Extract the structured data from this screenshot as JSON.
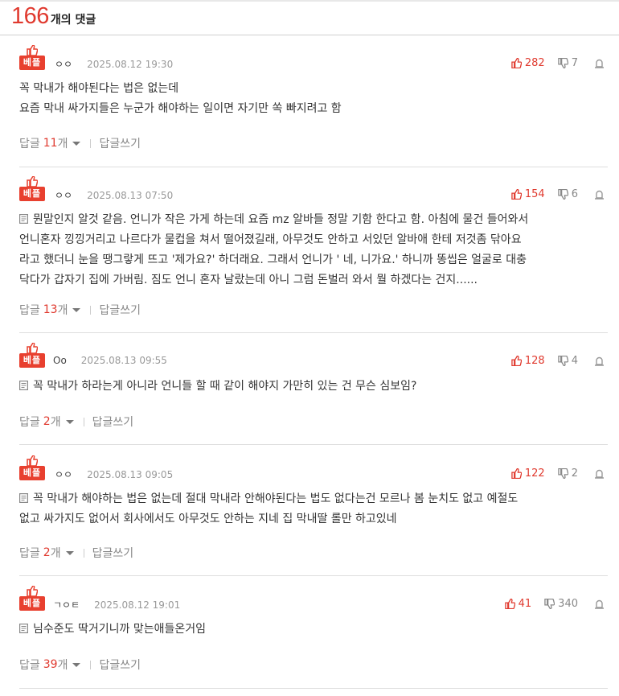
{
  "header": {
    "count": "166",
    "label": "개의 댓글"
  },
  "comments": [
    {
      "badge": "베플",
      "nick": "ㅇㅇ",
      "date": "2025.08.12 19:30",
      "up": "282",
      "down": "7",
      "lines": [
        "꼭 막내가 해야된다는 법은 없는데",
        "요즘 막내 싸가지들은 누군가 해야하는 일이면 자기만 쏙 빠지려고 함"
      ],
      "reply_label": "답글",
      "reply_count": "11",
      "reply_unit": "개",
      "write_label": "답글쓰기"
    },
    {
      "badge": "베플",
      "nick": "ㅇㅇ",
      "date": "2025.08.13 07:50",
      "up": "154",
      "down": "6",
      "lines": [
        "뭔말인지 알것 같음. 언니가 작은 가게 하는데 요즘 mz 알바들 정말 기함 한다고 함. 아침에 물건 들어와서",
        "언니혼자 낑낑거리고 나르다가 물컵을 쳐서 떨어졌길래, 아무것도 안하고 서있던 알바애 한테 저것좀 닦아요",
        "라고 했더니 눈을 땡그랗게 뜨고 '제가요?' 하더래요. 그래서 언니가 ' 네, 니가요.' 하니까 똥씹은 얼굴로 대충",
        "닥다가 갑자기 집에 가버림. 짐도 언니 혼자 날랐는데 아니 그럼 돈벌러 와서 뭘 하겠다는 건지......"
      ],
      "reply_label": "답글",
      "reply_count": "13",
      "reply_unit": "개",
      "write_label": "답글쓰기"
    },
    {
      "badge": "베플",
      "nick": "Oo",
      "date": "2025.08.13 09:55",
      "up": "128",
      "down": "4",
      "lines": [
        "꼭 막내가 하라는게 아니라 언니들 할 때 같이 해야지 가만히 있는 건 무슨 심보임?"
      ],
      "reply_label": "답글",
      "reply_count": "2",
      "reply_unit": "개",
      "write_label": "답글쓰기"
    },
    {
      "badge": "베플",
      "nick": "ㅇㅇ",
      "date": "2025.08.13 09:05",
      "up": "122",
      "down": "2",
      "lines": [
        "꼭 막내가 해야하는 법은 없는데 절대 막내라 안해야된다는 법도 없다는건 모르나 봄 눈치도 없고 예절도",
        "없고 싸가지도 없어서 회사에서도 아무것도 안하는 지네 집 막내딸 롤만 하고있네"
      ],
      "reply_label": "답글",
      "reply_count": "2",
      "reply_unit": "개",
      "write_label": "답글쓰기"
    },
    {
      "badge": "베플",
      "nick": "ㄱㅇㅌ",
      "date": "2025.08.12 19:01",
      "up": "41",
      "down": "340",
      "lines": [
        "님수준도 딱거기니까 맞는애들온거임"
      ],
      "reply_label": "답글",
      "reply_count": "39",
      "reply_unit": "개",
      "write_label": "답글쓰기"
    }
  ]
}
